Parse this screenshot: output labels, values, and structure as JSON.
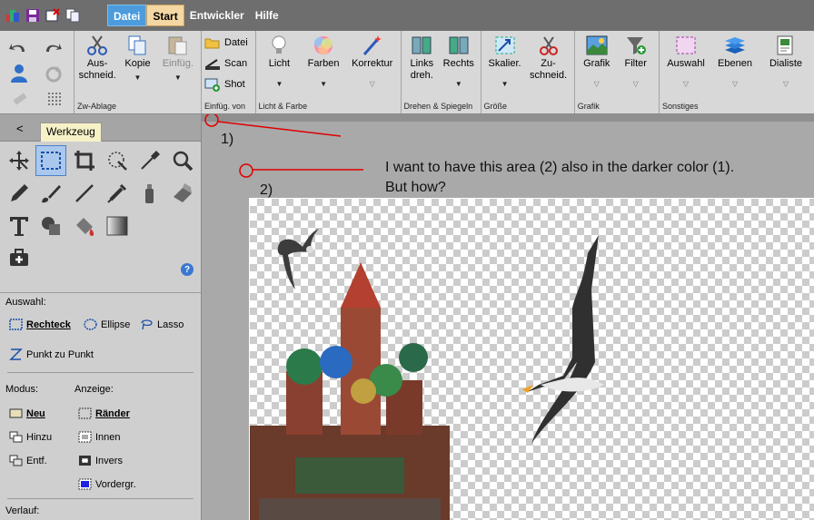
{
  "menu": {
    "items": [
      "Datei",
      "Start",
      "Entwickler",
      "Hilfe"
    ]
  },
  "ribbon": {
    "zwablage": {
      "label": "Zw-Ablage",
      "buttons": [
        {
          "label": "Aus-\nschneid."
        },
        {
          "label": "Kopie"
        },
        {
          "label": "Einfüg."
        }
      ]
    },
    "einfuegen": {
      "label": "Einfüg. von",
      "items": [
        "Datei",
        "Scan",
        "Shot"
      ]
    },
    "lichtfarbe": {
      "label": "Licht & Farbe",
      "buttons": [
        "Licht",
        "Farben",
        "Korrektur"
      ]
    },
    "drehen": {
      "label": "Drehen & Spiegeln",
      "buttons": [
        "Links\ndreh.",
        "Rechts"
      ]
    },
    "groesse": {
      "label": "Größe",
      "buttons": [
        "Skalier.",
        "Zu-\nschneid."
      ]
    },
    "grafik": {
      "label": "Grafik",
      "buttons": [
        "Grafik",
        "Filter"
      ]
    },
    "sonstiges": {
      "label": "Sonstiges",
      "buttons": [
        "Auswahl",
        "Ebenen",
        "Dialiste"
      ]
    }
  },
  "panel": {
    "back": "<",
    "tab": "Werkzeug",
    "help": "?",
    "auswahl_label": "Auswahl:",
    "auswahl": [
      "Rechteck",
      "Ellipse",
      "Lasso"
    ],
    "punkt": "Punkt zu Punkt",
    "modus_label": "Modus:",
    "modus": [
      "Neu",
      "Hinzu",
      "Entf."
    ],
    "anzeige_label": "Anzeige:",
    "anzeige": [
      "Ränder",
      "Innen",
      "Invers",
      "Vordergr."
    ],
    "verlauf_label": "Verlauf:"
  },
  "annotations": {
    "one": "1)",
    "two": "2)",
    "text1": "I want to have this area (2) also in the darker color (1).",
    "text2": "But how?"
  },
  "colors": {
    "menubar": "#6e6e6e",
    "accent": "#4c9bdc",
    "start_tab": "#f5d7a3",
    "annotation": "#e00000"
  }
}
